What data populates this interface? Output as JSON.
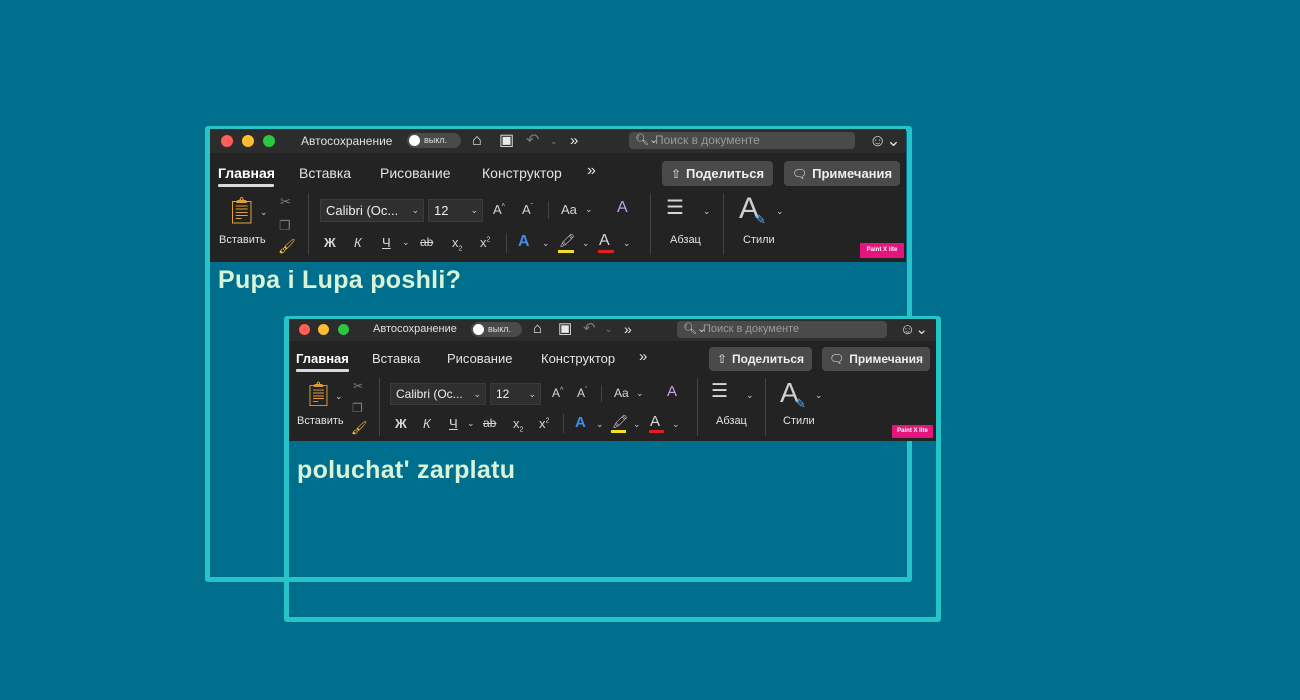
{
  "colors": {
    "background": "#006F8E",
    "frame": "#26C4C6",
    "window": "#232323",
    "doc_text": "#D8F4D8"
  },
  "window1": {
    "autosave_label": "Автосохранение",
    "toggle_label": "выкл.",
    "search_placeholder": "Поиск в документе",
    "tabs": [
      "Главная",
      "Вставка",
      "Рисование",
      "Конструктор"
    ],
    "more_tabs": "»",
    "share_label": "Поделиться",
    "notes_label": "Примечания",
    "paste_label": "Вставить",
    "font_name": "Calibri (Ос...",
    "font_size": "12",
    "bold": "Ж",
    "italic": "К",
    "underline": "Ч",
    "strike": "ab",
    "subscript": "x",
    "superscript": "x",
    "paragraph_label": "Абзац",
    "styles_label": "Стили",
    "badge": "Paint X lite",
    "doc_text": "Pupa i Lupa poshli?"
  },
  "window2": {
    "autosave_label": "Автосохранение",
    "toggle_label": "выкл.",
    "search_placeholder": "Поиск в документе",
    "tabs": [
      "Главная",
      "Вставка",
      "Рисование",
      "Конструктор"
    ],
    "more_tabs": "»",
    "share_label": "Поделиться",
    "notes_label": "Примечания",
    "paste_label": "Вставить",
    "font_name": "Calibri (Ос...",
    "font_size": "12",
    "bold": "Ж",
    "italic": "К",
    "underline": "Ч",
    "strike": "ab",
    "subscript": "x",
    "superscript": "x",
    "paragraph_label": "Абзац",
    "styles_label": "Стили",
    "badge": "Paint X lite",
    "doc_text": "poluchat' zarplatu"
  }
}
